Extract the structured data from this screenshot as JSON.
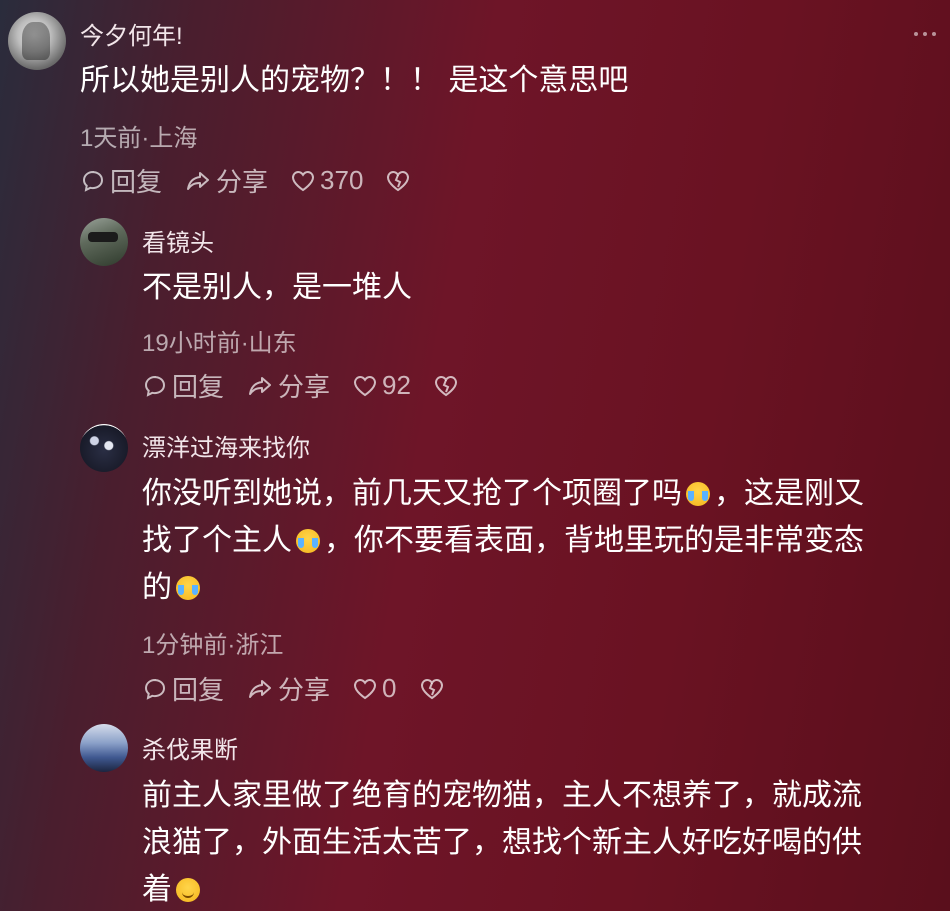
{
  "icons": {
    "reply": "chat-bubble-icon",
    "share": "share-arrow-icon",
    "like": "heart-icon",
    "dislike": "broken-heart-icon",
    "more": "more-dots-icon"
  },
  "comments": [
    {
      "username": "今夕何年!",
      "text": "所以她是别人的宠物？！！ 是这个意思吧",
      "meta": "1天前·上海",
      "reply_label": "回复",
      "share_label": "分享",
      "likes": "370"
    },
    {
      "username": "看镜头",
      "text": "不是别人，是一堆人",
      "meta": "19小时前·山东",
      "reply_label": "回复",
      "share_label": "分享",
      "likes": "92"
    },
    {
      "username": "漂洋过海来找你",
      "text_line1a": "你没听到她说，前几天又抢了个项圈了吗",
      "text_line1b": "，这是刚又",
      "text_line2a": "找了个主人",
      "text_line2b": "，你不要看表面，背地里玩的是非常变态",
      "text_line3a": "的",
      "meta": "1分钟前·浙江",
      "reply_label": "回复",
      "share_label": "分享",
      "likes": "0"
    },
    {
      "username": "杀伐果断",
      "text_line1": "前主人家里做了绝育的宠物猫，主人不想养了，就成流",
      "text_line2": "浪猫了，外面生活太苦了，想找个新主人好吃好喝的供",
      "text_line3": "着"
    }
  ]
}
